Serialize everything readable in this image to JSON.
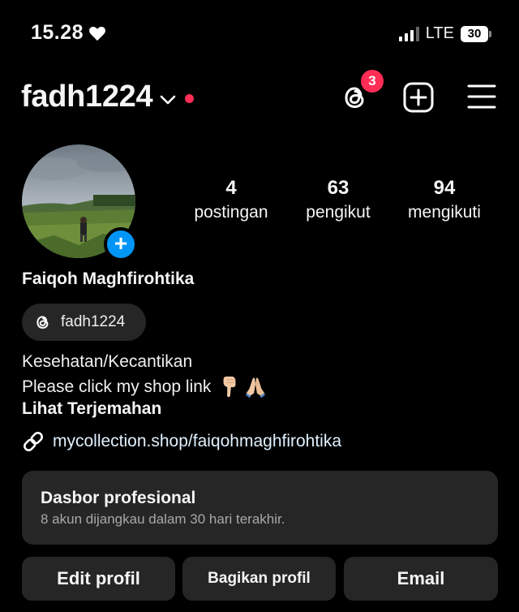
{
  "status_bar": {
    "time": "15.28",
    "network": "LTE",
    "battery": "30"
  },
  "header": {
    "username": "fadh1224",
    "threads_badge": "3"
  },
  "profile": {
    "stats": {
      "posts_count": "4",
      "posts_label": "postingan",
      "followers_count": "63",
      "followers_label": "pengikut",
      "following_count": "94",
      "following_label": "mengikuti"
    },
    "full_name": "Faiqoh Maghfirohtika",
    "threads_handle": "fadh1224",
    "category": "Kesehatan/Kecantikan",
    "bio": "Please click my shop link",
    "translate_label": "Lihat Terjemahan",
    "link": "mycollection.shop/faiqohmaghfirohtika"
  },
  "dashboard": {
    "title": "Dasbor profesional",
    "subtitle": "8 akun dijangkau dalam 30 hari terakhir."
  },
  "actions": {
    "edit": "Edit profil",
    "share": "Bagikan profil",
    "email": "Email"
  },
  "colors": {
    "background": "#000000",
    "surface": "#262626",
    "accent_blue": "#0095f6",
    "badge_red": "#ff2d55"
  }
}
